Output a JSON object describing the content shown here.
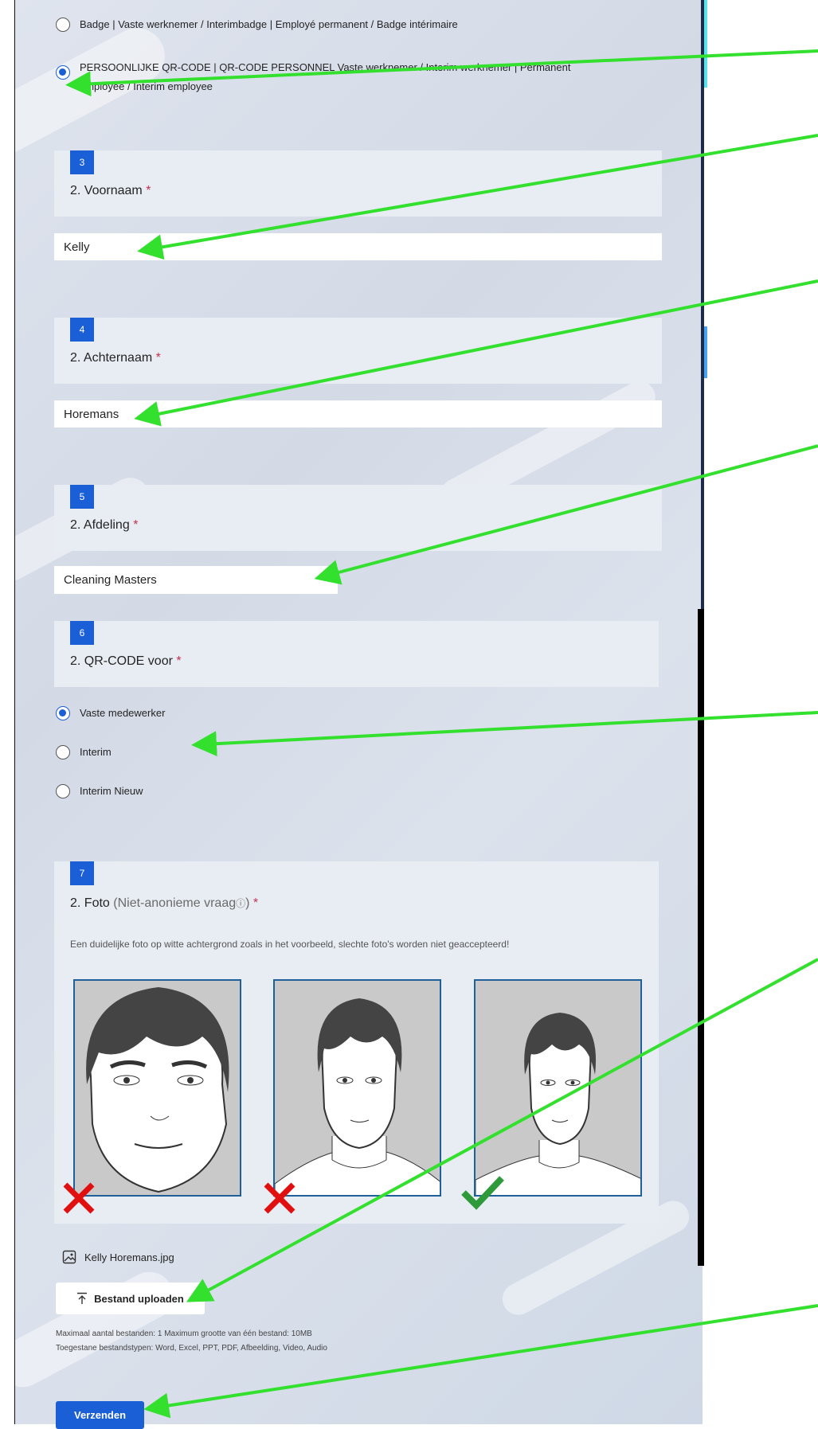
{
  "options_q2": [
    {
      "label": "Badge | Vaste werknemer / Interimbadge | Employé permanent / Badge intérimaire",
      "selected": false
    },
    {
      "label": "PERSOONLIJKE QR-CODE | QR-CODE PERSONNEL  Vaste werknemer / Interim werknemer | Permanent employee / Interim employee",
      "selected": true
    }
  ],
  "q3": {
    "number": "3",
    "title": "2. Voornaam",
    "required_mark": "*",
    "value": "Kelly"
  },
  "q4": {
    "number": "4",
    "title": "2. Achternaam",
    "required_mark": "*",
    "value": "Horemans"
  },
  "q5": {
    "number": "5",
    "title": "2. Afdeling",
    "required_mark": "*",
    "value": "Cleaning Masters"
  },
  "q6": {
    "number": "6",
    "title": "2. QR-CODE voor",
    "required_mark": "*",
    "options": [
      {
        "label": "Vaste medewerker",
        "selected": true
      },
      {
        "label": "Interim",
        "selected": false
      },
      {
        "label": "Interim Nieuw",
        "selected": false
      }
    ]
  },
  "q7": {
    "number": "7",
    "title": "2. Foto",
    "note": "(Niet-anonieme vraag",
    "info_glyph": "ⓘ",
    "note_close": ")",
    "required_mark": "*",
    "description": "Een duidelijke foto op witte achtergrond zoals in het voorbeeld, slechte foto's worden niet geaccepteerd!",
    "uploaded_file": "Kelly Horemans.jpg",
    "upload_label": "Bestand uploaden",
    "limits_line1": "Maximaal aantal bestanden: 1   Maximum grootte van één bestand: 10MB",
    "limits_line2": "Toegestane bestandstypen: Word, Excel, PPT, PDF, Afbeelding, Video, Audio"
  },
  "submit_label": "Verzenden",
  "colors": {
    "accent": "#1b5fd6",
    "arrow": "#33e02e",
    "required": "#c4314b",
    "reject": "#e01010",
    "accept": "#2e9a3a"
  }
}
